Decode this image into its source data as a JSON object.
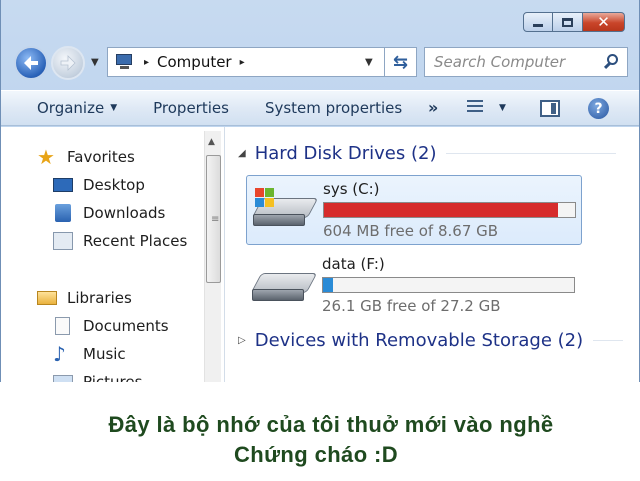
{
  "window": {
    "controls": {
      "minimize_icon": "minimize-icon",
      "maximize_icon": "maximize-icon",
      "close_glyph": "✕"
    }
  },
  "navbar": {
    "address": {
      "location": "Computer",
      "separator": "▸"
    },
    "search": {
      "placeholder": "Search Computer"
    },
    "refresh_glyph": "⇆"
  },
  "toolbar": {
    "items": [
      "Organize",
      "Properties",
      "System properties"
    ],
    "more": "»",
    "help": "?"
  },
  "sidebar": {
    "favorites": {
      "label": "Favorites",
      "items": [
        "Desktop",
        "Downloads",
        "Recent Places"
      ]
    },
    "libraries": {
      "label": "Libraries",
      "items": [
        "Documents",
        "Music",
        "Pictures"
      ]
    }
  },
  "content": {
    "groups": [
      {
        "title": "Hard Disk Drives (2)",
        "drives": [
          {
            "name": "sys (C:)",
            "free_text": "604 MB free of 8.67 GB",
            "used_fraction": 0.932,
            "bar_color": "#d62b2b",
            "selected": true,
            "system_drive": true
          },
          {
            "name": "data (F:)",
            "free_text": "26.1 GB free of 27.2 GB",
            "used_fraction": 0.04,
            "bar_color": "#2a8bd6",
            "selected": false,
            "system_drive": false
          }
        ]
      },
      {
        "title": "Devices with Removable Storage (2)",
        "collapsed": true
      }
    ]
  },
  "caption": {
    "line1": "Đây là bộ nhớ của tôi thuở mới vào nghề",
    "line2": "Chứng cháo :D",
    "color": "#1f4a1f"
  }
}
